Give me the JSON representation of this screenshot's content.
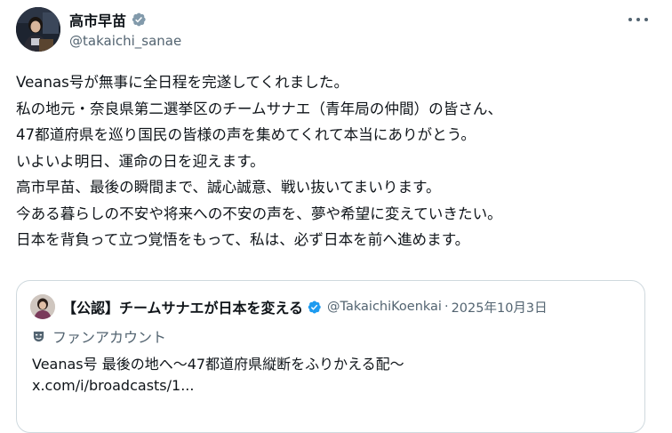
{
  "author": {
    "display_name": "高市早苗",
    "handle": "@takaichi_sanae",
    "verified_color": "#829aab"
  },
  "more_icon": "more-horizontal-icon",
  "tweet": {
    "lines": [
      "Veanas号が無事に全日程を完遂してくれました。",
      "私の地元・奈良県第二選挙区のチームサナエ（青年局の仲間）の皆さん、",
      "47都道府県を巡り国民の皆様の声を集めてくれて本当にありがとう。",
      "いよいよ明日、運命の日を迎えます。",
      "高市早苗、最後の瞬間まで、誠心誠意、戦い抜いてまいります。",
      "今ある暮らしの不安や将来への不安の声を、夢や希望に変えていきたい。",
      "日本を背負って立つ覚悟をもって、私は、必ず日本を前へ進めます。"
    ]
  },
  "quote": {
    "display_name": "【公認】チームサナエが日本を変える",
    "handle": "@TakaichiKoenkai",
    "separator": "·",
    "date": "2025年10月3日",
    "verified_color": "#1d9bf0",
    "label": "ファンアカウント",
    "label_icon": "theater-mask-icon",
    "text_line1": "Veanas号 最後の地へ～47都道府県縦断をふりかえる配～",
    "text_line2": "x.com/i/broadcasts/1..."
  }
}
